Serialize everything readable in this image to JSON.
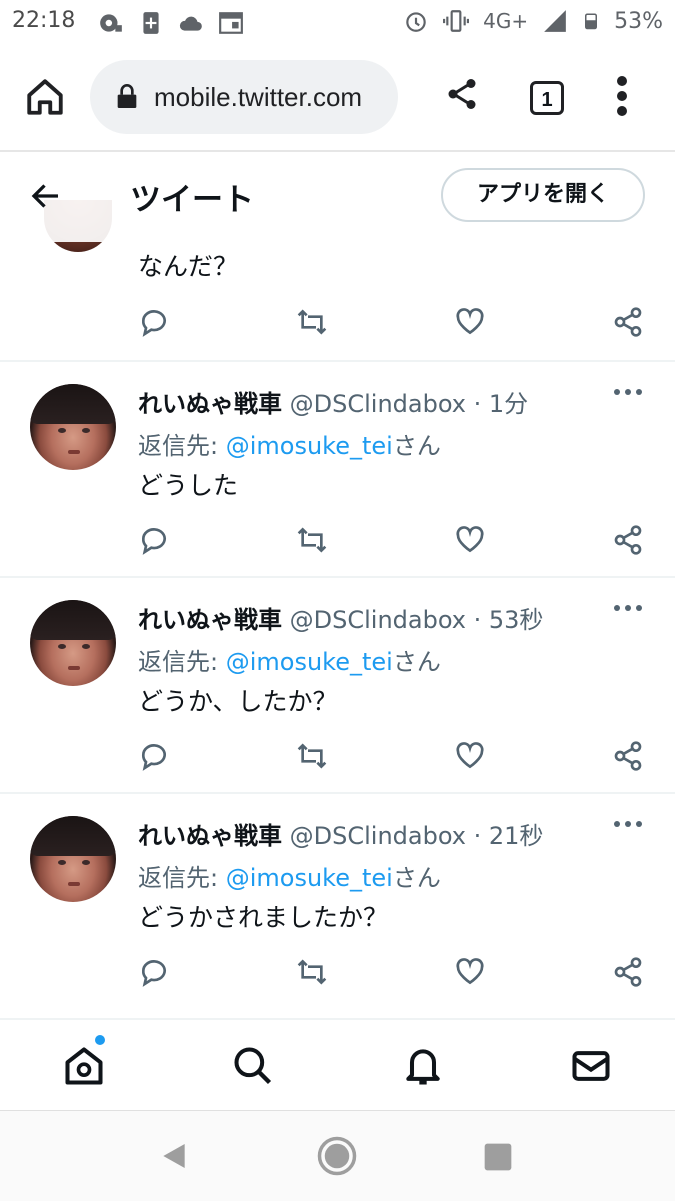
{
  "status_bar": {
    "time": "22:18",
    "network": "4G+",
    "battery": "53%"
  },
  "browser": {
    "url": "mobile.twitter.com",
    "tab_count": "1"
  },
  "header": {
    "title": "ツイート",
    "open_app": "アプリを開く"
  },
  "partial_tweet": {
    "text": "なんだ？"
  },
  "tweets": [
    {
      "name": "れいぬゃ戦車",
      "handle": "@DSClindabox",
      "time": "· 1分",
      "reply_prefix": "返信先: ",
      "reply_to": "@imosuke_tei",
      "reply_suffix": "さん",
      "text": "どうした"
    },
    {
      "name": "れいぬゃ戦車",
      "handle": "@DSClindabox",
      "time": "· 53秒",
      "reply_prefix": "返信先: ",
      "reply_to": "@imosuke_tei",
      "reply_suffix": "さん",
      "text": "どうか、したか？"
    },
    {
      "name": "れいぬゃ戦車",
      "handle": "@DSClindabox",
      "time": "· 21秒",
      "reply_prefix": "返信先: ",
      "reply_to": "@imosuke_tei",
      "reply_suffix": "さん",
      "text": "どうかされましたか？"
    }
  ],
  "colors": {
    "link": "#1d9bf0",
    "secondary_text": "#536471",
    "icon": "#536471"
  }
}
